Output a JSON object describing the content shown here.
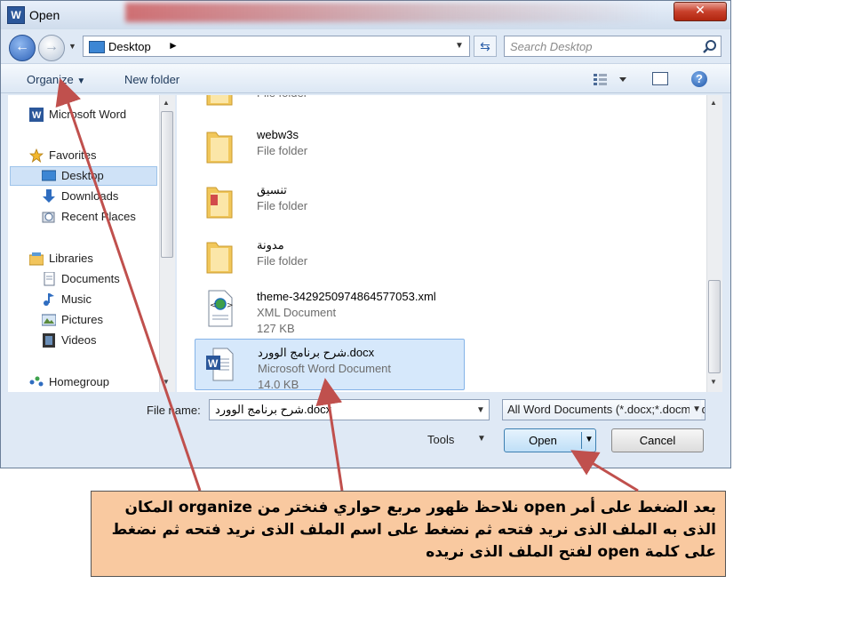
{
  "window": {
    "title": "Open",
    "app_icon": "word-icon",
    "close_label": "✕"
  },
  "nav": {
    "address": "Desktop",
    "search_placeholder": "Search Desktop"
  },
  "toolbar": {
    "organize_label": "Organize",
    "new_folder_label": "New folder"
  },
  "sidebar": {
    "items": [
      {
        "label": "Microsoft Word",
        "icon": "word-icon"
      },
      {
        "label": "Favorites",
        "icon": "star-icon"
      },
      {
        "label": "Desktop",
        "icon": "desktop-icon",
        "selected": true
      },
      {
        "label": "Downloads",
        "icon": "download-icon"
      },
      {
        "label": "Recent Places",
        "icon": "recent-places-icon"
      },
      {
        "label": "Libraries",
        "icon": "library-icon"
      },
      {
        "label": "Documents",
        "icon": "documents-icon"
      },
      {
        "label": "Music",
        "icon": "music-icon"
      },
      {
        "label": "Pictures",
        "icon": "pictures-icon"
      },
      {
        "label": "Videos",
        "icon": "videos-icon"
      },
      {
        "label": "Homegroup",
        "icon": "homegroup-icon"
      }
    ]
  },
  "files": [
    {
      "name": "",
      "type": "File folder",
      "size": "",
      "icon": "folder-icon"
    },
    {
      "name": "webw3s",
      "type": "File folder",
      "size": "",
      "icon": "folder-icon"
    },
    {
      "name": "تنسيق",
      "type": "File folder",
      "size": "",
      "icon": "folder-icon"
    },
    {
      "name": "مدونة",
      "type": "File folder",
      "size": "",
      "icon": "folder-icon"
    },
    {
      "name": "theme-3429250974864577053.xml",
      "type": "XML Document",
      "size": "127 KB",
      "icon": "xml-document-icon"
    },
    {
      "name": "شرح برنامج الوورد.docx",
      "type": "Microsoft Word Document",
      "size": "14.0 KB",
      "icon": "word-document-icon",
      "selected": true
    }
  ],
  "bottom": {
    "file_name_label": "File name:",
    "file_name_value": "شرح برنامج الوورد.docx",
    "filter_value": "All Word Documents (*.docx;*.docm;*.dotx;*.dotm;*.doc;*.dot;*.htm;*.html;*.rtf;*.mht;*.mhtml;*.xml;*.odt)",
    "tools_label": "Tools",
    "open_label": "Open",
    "cancel_label": "Cancel"
  },
  "note": {
    "text": "بعد الضغط على أمر open نلاحظ ظهور مربع حواري فنختر من organize المكان الذى به الملف الذى نريد فتحه  ثم نضغط على اسم الملف الذى نريد فتحه ثم نضغط على كلمة open لفتح الملف الذى نريده",
    "background": "#f9c9a0",
    "arrow_color": "#c0504d"
  }
}
